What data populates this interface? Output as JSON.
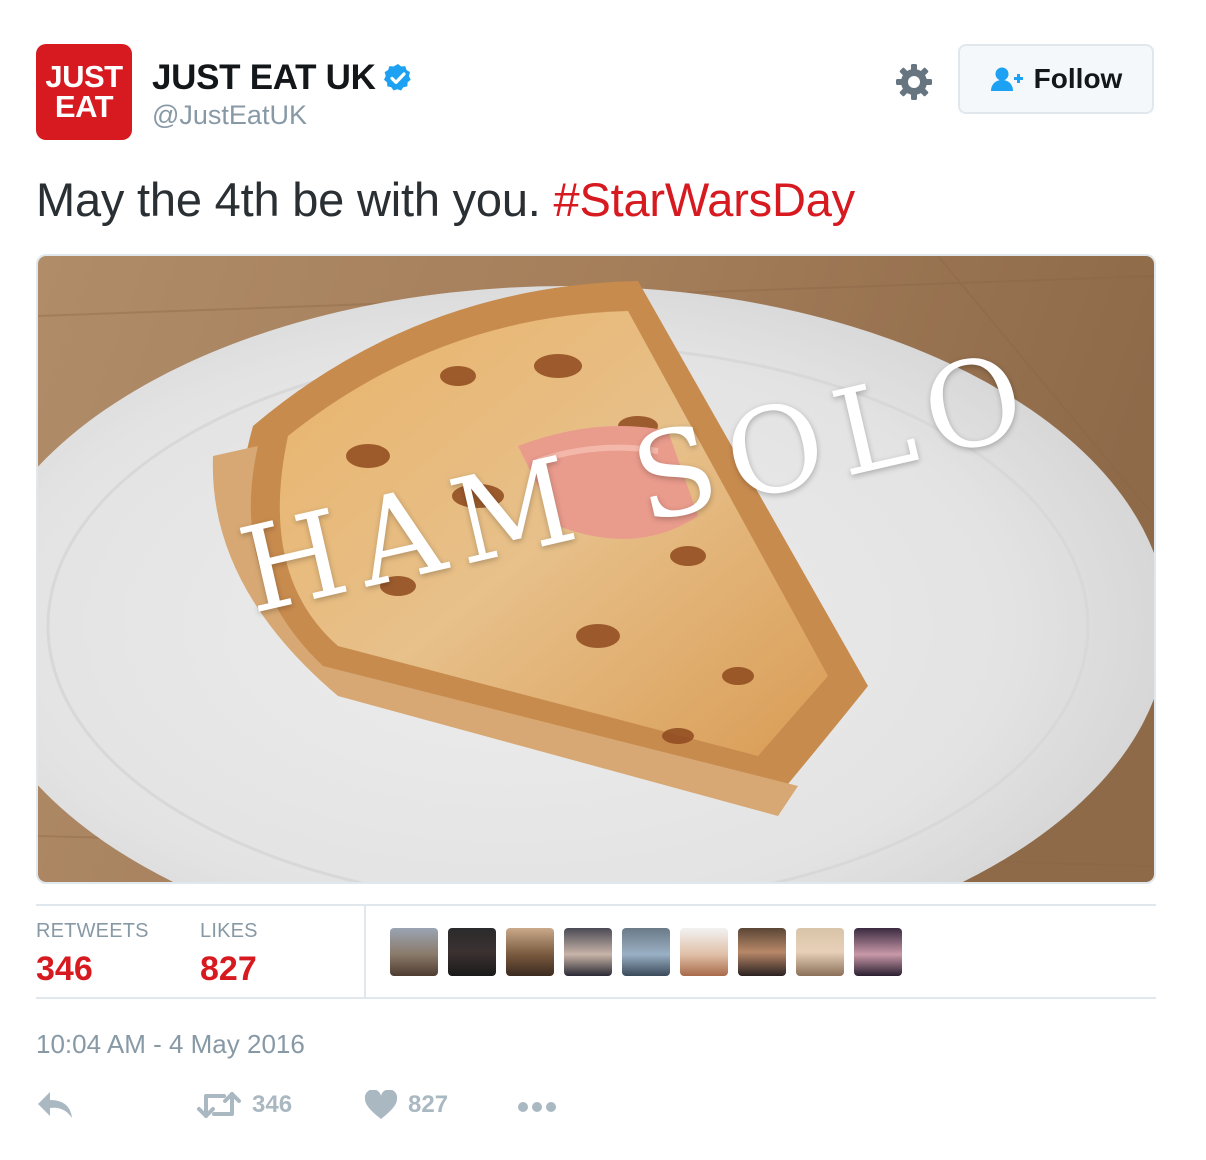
{
  "account": {
    "logo_line1": "JUST",
    "logo_line2": "EAT",
    "display_name": "JUST EAT UK",
    "handle": "@JustEatUK"
  },
  "follow_label": "Follow",
  "tweet": {
    "text": "May the 4th be with you. ",
    "hashtag": "#StarWarsDay",
    "image_caption": "HAM SOLO"
  },
  "stats": {
    "retweets_label": "RETWEETS",
    "retweets_count": "346",
    "likes_label": "LIKES",
    "likes_count": "827"
  },
  "timestamp": "10:04 AM - 4 May 2016",
  "actions": {
    "retweet_count": "346",
    "like_count": "827"
  },
  "colors": {
    "brand_red": "#d71920",
    "verified_blue": "#1da1f2",
    "muted_gray": "#8899a6"
  },
  "icons": [
    "verified-badge-icon",
    "gear-icon",
    "follow-person-icon",
    "reply-icon",
    "retweet-icon",
    "heart-icon",
    "more-icon"
  ]
}
